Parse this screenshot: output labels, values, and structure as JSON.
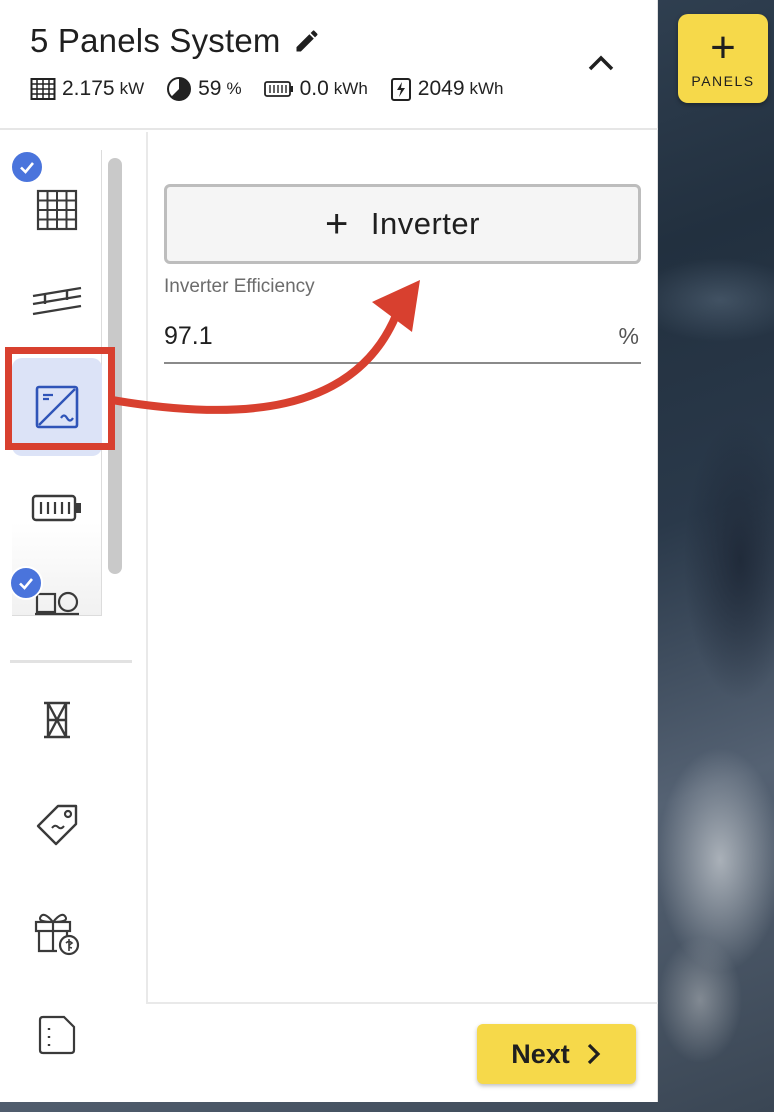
{
  "system": {
    "title": "5 Panels System",
    "stats": {
      "power_value": "2.175",
      "power_unit": "kW",
      "offset_value": "59",
      "offset_unit": "%",
      "battery_value": "0.0",
      "battery_unit": "kWh",
      "energy_value": "2049",
      "energy_unit": "kWh"
    }
  },
  "panels_button": {
    "label": "PANELS",
    "icon": "plus-icon"
  },
  "sidebar": {
    "items": [
      {
        "icon": "solar-panel-icon",
        "checked": true
      },
      {
        "icon": "mounting-rails-icon",
        "checked": false
      },
      {
        "icon": "inverter-icon",
        "checked": false,
        "active": true
      },
      {
        "icon": "battery-icon",
        "checked": false
      },
      {
        "icon": "devices-icon",
        "checked": true
      },
      {
        "icon": "tower-icon",
        "checked": false
      },
      {
        "icon": "price-tag-icon",
        "checked": false
      },
      {
        "icon": "incentive-gift-icon",
        "checked": false
      },
      {
        "icon": "document-icon",
        "checked": false
      }
    ]
  },
  "main": {
    "add_inverter_label": "Inverter",
    "efficiency_label": "Inverter Efficiency",
    "efficiency_value": "97.1",
    "efficiency_unit": "%"
  },
  "footer": {
    "next_label": "Next"
  },
  "colors": {
    "accent_yellow": "#f6d94a",
    "check_blue": "#4a74dc",
    "active_bg": "#dce3f7",
    "annotation_red": "#d8402f"
  }
}
